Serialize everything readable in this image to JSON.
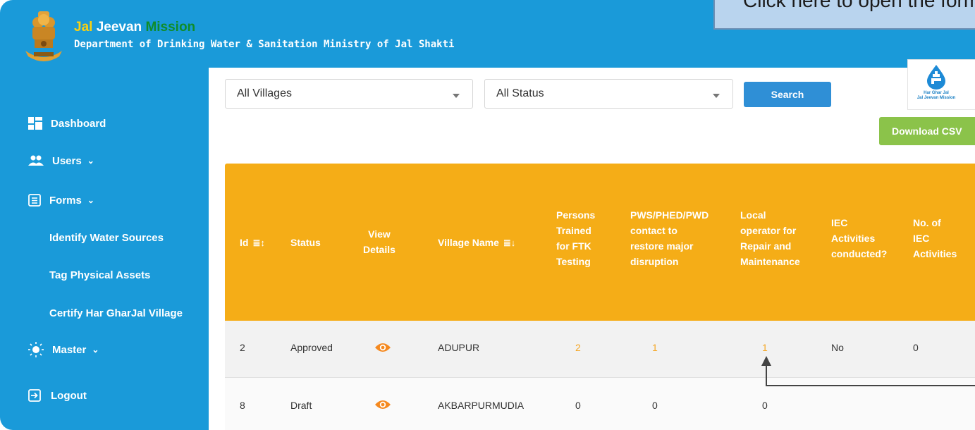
{
  "header": {
    "title_part1": "Jal",
    "title_part2": "Jeevan",
    "title_part3": "Mission",
    "subtitle": "Department of Drinking Water & Sanitation Ministry of Jal Shakti",
    "logo_text_line1": "Har Ghar Jal",
    "logo_text_line2": "Jal Jeevan Mission"
  },
  "callout": {
    "text": "Click here to open the form"
  },
  "sidebar": {
    "dashboard": "Dashboard",
    "users": "Users",
    "forms": "Forms",
    "identify": "Identify Water Sources",
    "tag": "Tag Physical Assets",
    "certify": "Certify Har GharJal Village",
    "master": "Master",
    "logout": "Logout"
  },
  "filters": {
    "village": "All Villages",
    "status": "All Status",
    "search": "Search",
    "download": "Download CSV"
  },
  "table": {
    "columns": {
      "id": "Id",
      "status": "Status",
      "view_l1": "View",
      "view_l2": "Details",
      "village": "Village Name",
      "persons": [
        "Persons",
        "Trained",
        "for FTK",
        "Testing"
      ],
      "pws": [
        "PWS/PHED/PWD",
        "contact to",
        "restore major",
        "disruption"
      ],
      "local": [
        "Local",
        "operator for",
        "Repair and",
        "Maintenance"
      ],
      "iec": [
        "IEC",
        "Activities",
        "conducted?"
      ],
      "noiec": [
        "No. of",
        "IEC",
        "Activities"
      ]
    },
    "rows": [
      {
        "id": "2",
        "status": "Approved",
        "village": "ADUPUR",
        "persons": "2",
        "pws": "1",
        "local": "1",
        "iec": "No",
        "noiec": "0"
      },
      {
        "id": "8",
        "status": "Draft",
        "village": "AKBARPURMUDIA",
        "persons": "0",
        "pws": "0",
        "local": "0",
        "iec": "",
        "noiec": ""
      }
    ]
  },
  "colors": {
    "primary": "#1a9ad9",
    "table_header": "#f5ad17",
    "accent_orange": "#f5a623",
    "csv_button": "#8bc34a"
  }
}
